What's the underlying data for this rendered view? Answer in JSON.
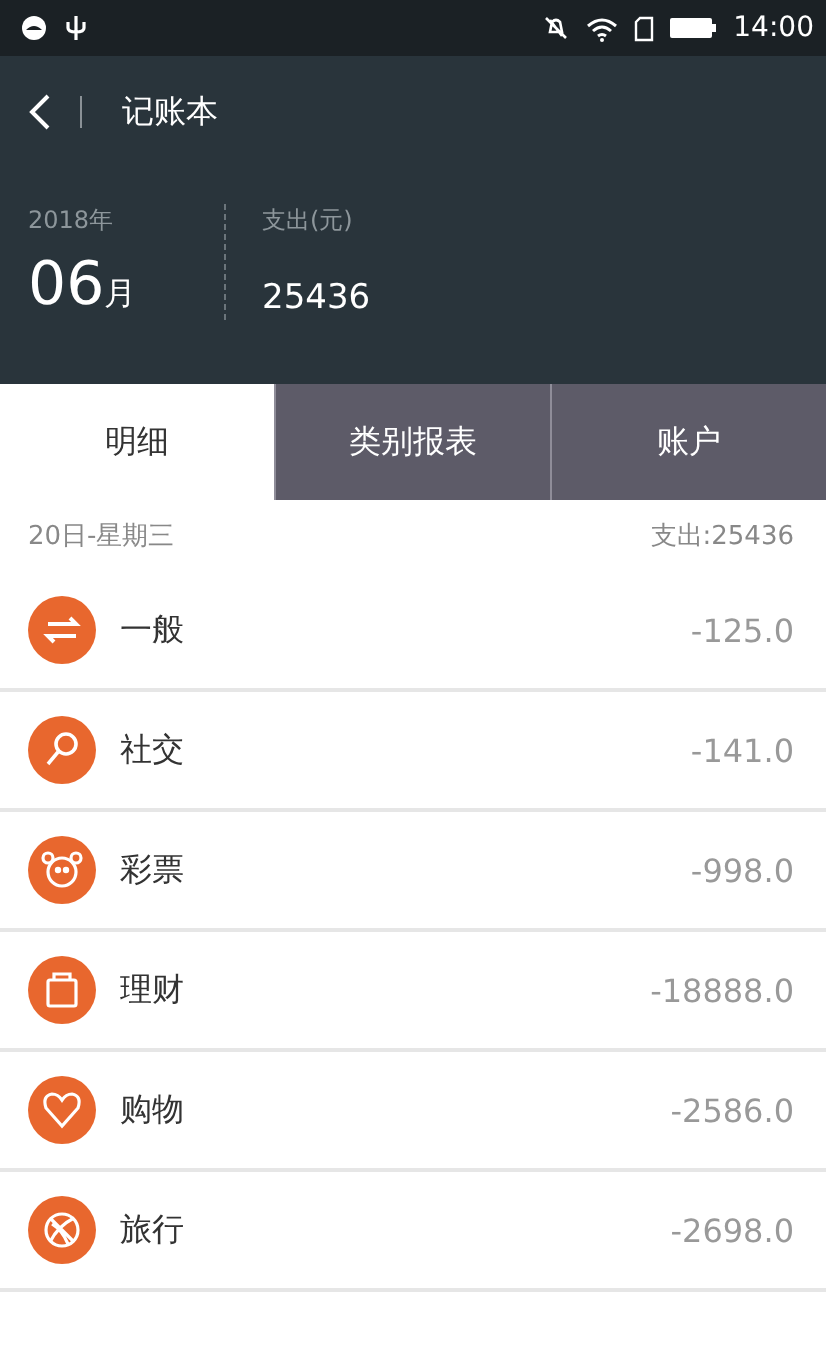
{
  "status_bar": {
    "time": "14:00"
  },
  "header": {
    "title": "记账本",
    "year": "2018年",
    "month": "06",
    "month_unit": "月",
    "expense_label": "支出(元)",
    "expense_total": "25436"
  },
  "tabs": [
    {
      "label": "明细",
      "selected": true
    },
    {
      "label": "类别报表",
      "selected": false
    },
    {
      "label": "账户",
      "selected": false
    }
  ],
  "day": {
    "date": "20日-星期三",
    "summary": "支出:25436"
  },
  "entries": [
    {
      "category": "一般",
      "amount": "-125.0"
    },
    {
      "category": "社交",
      "amount": "-141.0"
    },
    {
      "category": "彩票",
      "amount": "-998.0"
    },
    {
      "category": "理财",
      "amount": "-18888.0"
    },
    {
      "category": "购物",
      "amount": "-2586.0"
    },
    {
      "category": "旅行",
      "amount": "-2698.0"
    }
  ]
}
